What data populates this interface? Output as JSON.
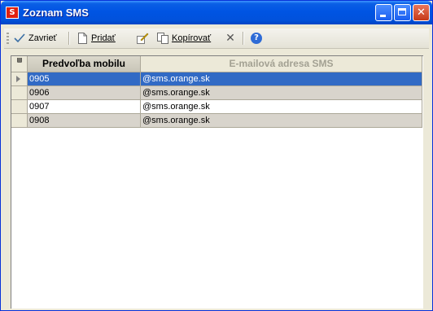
{
  "window": {
    "title": "Zoznam SMS",
    "app_icon_glyph": "S",
    "minimize_glyph": "_",
    "close_glyph": "✕"
  },
  "toolbar": {
    "close_label": "Zavrieť",
    "add_label": "Pridať",
    "copy_label": "Kopírovať",
    "delete_glyph": "✕",
    "help_glyph": "?"
  },
  "grid": {
    "columns": [
      "Predvoľba mobilu",
      "E-mailová adresa SMS"
    ],
    "rows": [
      {
        "prefix": "0905",
        "email": "@sms.orange.sk"
      },
      {
        "prefix": "0906",
        "email": "@sms.orange.sk"
      },
      {
        "prefix": "0907",
        "email": "@sms.orange.sk"
      },
      {
        "prefix": "0908",
        "email": "@sms.orange.sk"
      }
    ],
    "selected_row": 0
  },
  "colors": {
    "titlebar": "#0054e3",
    "selection": "#316ac5",
    "alt_row": "#d8d4cc",
    "close_button": "#c63a18"
  }
}
